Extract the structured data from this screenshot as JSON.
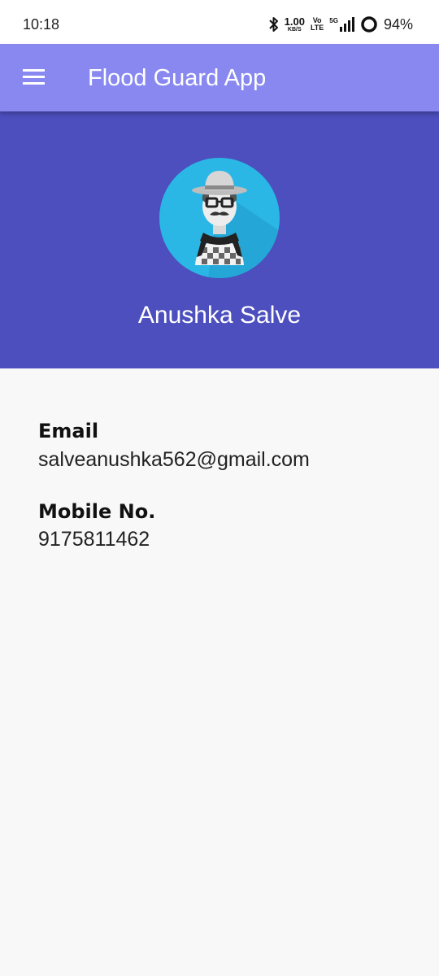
{
  "status_bar": {
    "time": "10:18",
    "net_speed": "1.00",
    "net_speed_unit": "KB/S",
    "volte_top": "Vo",
    "volte_bottom": "LTE",
    "network_type": "5G",
    "battery_percent": "94%",
    "icons": [
      "bluetooth-icon",
      "signal-icon",
      "battery-icon"
    ]
  },
  "app_bar": {
    "title": "Flood Guard App",
    "menu_icon": "menu-icon",
    "background_color": "#8888f0"
  },
  "profile": {
    "name": "Anushka Salve",
    "avatar_icon": "user-avatar-icon",
    "header_color": "#4c4fbd"
  },
  "details": {
    "email_label": "Email",
    "email_value": "salveanushka562@gmail.com",
    "mobile_label": "Mobile No.",
    "mobile_value": "9175811462"
  }
}
